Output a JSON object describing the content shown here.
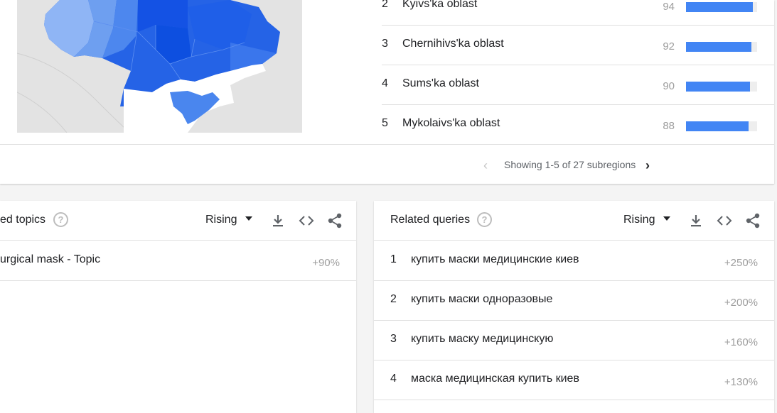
{
  "regions": {
    "rows": [
      {
        "rank": "2",
        "name": "Kyivs'ka oblast",
        "value": "94",
        "fraction": 0.94
      },
      {
        "rank": "3",
        "name": "Chernihivs'ka oblast",
        "value": "92",
        "fraction": 0.92
      },
      {
        "rank": "4",
        "name": "Sums'ka oblast",
        "value": "90",
        "fraction": 0.9
      },
      {
        "rank": "5",
        "name": "Mykolaivs'ka oblast",
        "value": "88",
        "fraction": 0.88
      }
    ],
    "pager_text": "Showing 1-5 of 27 subregions"
  },
  "related_topics": {
    "title": "ed topics",
    "filter": "Rising",
    "rows": [
      {
        "text": "urgical mask - Topic",
        "value": "+90%"
      }
    ]
  },
  "related_queries": {
    "title": "Related queries",
    "filter": "Rising",
    "rows": [
      {
        "rank": "1",
        "text": "купить маски медицинские киев",
        "value": "+250%"
      },
      {
        "rank": "2",
        "text": "купить маски одноразовые",
        "value": "+200%"
      },
      {
        "rank": "3",
        "text": "купить маску медицинскую",
        "value": "+160%"
      },
      {
        "rank": "4",
        "text": "маска медицинская купить киев",
        "value": "+130%"
      }
    ]
  },
  "icons": {
    "help": "question-circle-icon",
    "download": "download-icon",
    "embed": "code-icon",
    "share": "share-icon",
    "prev": "chevron-left-icon",
    "next": "chevron-right-icon"
  },
  "colors": {
    "bar": "#4285f4",
    "map_dark": "#1a5ce8",
    "map_light": "#8fb5f5",
    "muted": "#9e9e9e"
  }
}
